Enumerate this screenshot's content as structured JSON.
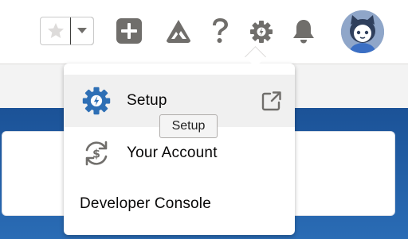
{
  "header": {
    "icons": [
      "star-icon",
      "chevron-down-icon",
      "add-icon",
      "trailhead-icon",
      "help-icon",
      "gear-icon",
      "bell-icon",
      "avatar"
    ]
  },
  "menu": {
    "items": [
      {
        "label": "Setup",
        "icon": "gear-bolt-icon",
        "external": true
      },
      {
        "label": "Your Account",
        "icon": "account-refresh-dollar-icon"
      },
      {
        "label": "Developer Console"
      }
    ]
  },
  "tooltip": {
    "text": "Setup"
  },
  "colors": {
    "icon_gray": "#706e6b",
    "setup_blue": "#2e6fb5",
    "banner_blue": "#1b5297",
    "hover_bg": "#f0f0f0"
  }
}
